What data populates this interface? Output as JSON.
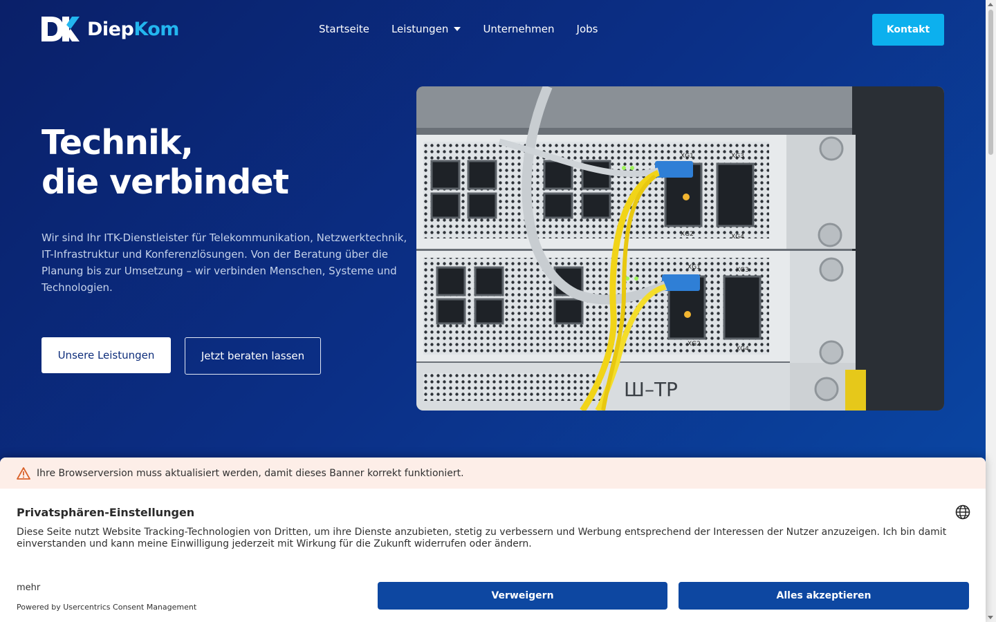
{
  "header": {
    "logo_name_part1": "Diep",
    "logo_name_part2": "Kom",
    "nav": [
      {
        "label": "Startseite"
      },
      {
        "label": "Leistungen"
      },
      {
        "label": "Unternehmen"
      },
      {
        "label": "Jobs"
      }
    ],
    "contact_label": "Kontakt"
  },
  "hero": {
    "title_line1": "Technik,",
    "title_line2": "die verbindet",
    "description": "Wir sind Ihr ITK-Dienstleister für Telekommunikation, Netzwerktechnik, IT-Infrastruktur und Konferenzlösungen. Von der Beratung über die Planung bis zur Umsetzung – wir verbinden Menschen, Systeme und Technologien.",
    "primary_button": "Unsere Leistungen",
    "secondary_button": "Jetzt beraten lassen"
  },
  "consent": {
    "warning_text": "Ihre Browserversion muss aktualisiert werden, damit dieses Banner korrekt funktioniert.",
    "title": "Privatsphären-Einstellungen",
    "text": "Diese Seite nutzt Website Tracking-Technologien von Dritten, um ihre Dienste anzubieten, stetig zu verbessern und Werbung entsprechend der Interessen der Nutzer anzuzeigen. Ich bin damit einverstanden und kann meine Einwilligung jederzeit mit Wirkung für die Zukunft widerrufen oder ändern.",
    "more_label": "mehr",
    "powered_by": "Powered by Usercentrics Consent Management",
    "deny_label": "Verweigern",
    "accept_label": "Alles akzeptieren"
  },
  "image_labels": {
    "xg1": "XG1",
    "xg2": "XG2",
    "xg3": "XG3",
    "xg4": "XG4",
    "panel_text": "Ш–ТР"
  },
  "colors": {
    "brand_accent": "#23b6ef",
    "contact_button": "#0cb0ee",
    "consent_button": "#0d47a1",
    "hero_background": "#0b2f86"
  }
}
